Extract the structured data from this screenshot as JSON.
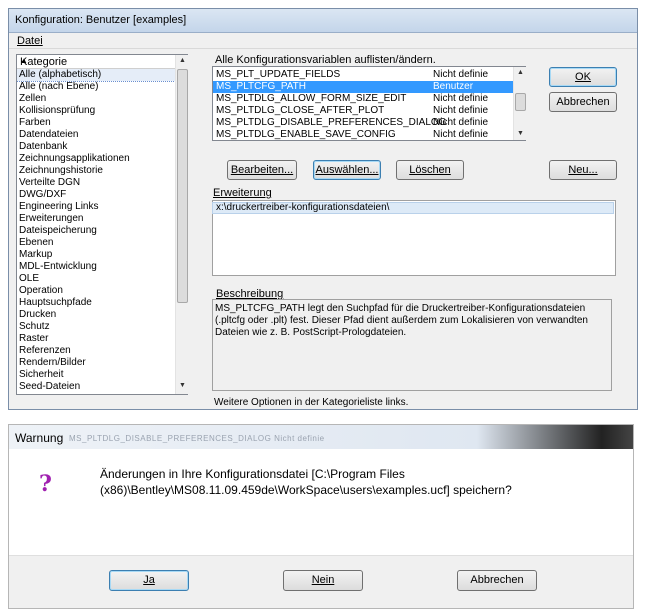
{
  "window": {
    "title": "Konfiguration: Benutzer [examples]"
  },
  "menu": {
    "datei": "Datei"
  },
  "categories": {
    "header": "Kategorie",
    "items": [
      "Alle (alphabetisch)",
      "Alle (nach Ebene)",
      "Zellen",
      "Kollisionsprüfung",
      "Farben",
      "Datendateien",
      "Datenbank",
      "Zeichnungsapplikationen",
      "Zeichnungshistorie",
      "Verteilte DGN",
      "DWG/DXF",
      "Engineering Links",
      "Erweiterungen",
      "Dateispeicherung",
      "Ebenen",
      "Markup",
      "MDL-Entwicklung",
      "OLE",
      "Operation",
      "Hauptsuchpfade",
      "Drucken",
      "Schutz",
      "Raster",
      "Referenzen",
      "Rendern/Bilder",
      "Sicherheit",
      "Seed-Dateien"
    ],
    "selected_index": 0
  },
  "variables": {
    "label": "Alle Konfigurationsvariablen auflisten/ändern.",
    "rows": [
      {
        "name": "MS_PLT_UPDATE_FIELDS",
        "value": "Nicht definie"
      },
      {
        "name": "MS_PLTCFG_PATH",
        "value": "Benutzer"
      },
      {
        "name": "MS_PLTDLG_ALLOW_FORM_SIZE_EDIT",
        "value": "Nicht definie"
      },
      {
        "name": "MS_PLTDLG_CLOSE_AFTER_PLOT",
        "value": "Nicht definie"
      },
      {
        "name": "MS_PLTDLG_DISABLE_PREFERENCES_DIALOG",
        "value": "Nicht definie"
      },
      {
        "name": "MS_PLTDLG_ENABLE_SAVE_CONFIG",
        "value": "Nicht definie"
      }
    ],
    "selected_index": 1
  },
  "buttons": {
    "ok": "OK",
    "abbrechen": "Abbrechen",
    "bearbeiten": "Bearbeiten...",
    "auswaehlen": "Auswählen...",
    "loeschen": "Löschen",
    "neu": "Neu..."
  },
  "erweiterung": {
    "label": "Erweiterung",
    "value": "x:\\druckertreiber-konfigurationsdateien\\"
  },
  "beschreibung": {
    "label": "Beschreibung",
    "text": "MS_PLTCFG_PATH legt den Suchpfad für die Druckertreiber-Konfigurationsdateien (.pltcfg oder .plt) fest. Dieser Pfad dient außerdem zum Lokalisieren von verwandten Dateien wie z. B. PostScript-Prologdateien."
  },
  "footer": "Weitere Optionen in der Kategorieliste links.",
  "warning": {
    "title": "Warnung",
    "ghost_text": "MS_PLTDLG_DISABLE_PREFERENCES_DIALOG    Nicht definie",
    "icon": "question-icon",
    "icon_glyph": "?",
    "icon_color": "#a020b0",
    "message": "Änderungen in Ihre Konfigurationsdatei [C:\\Program Files (x86)\\Bentley\\MS08.11.09.459de\\WorkSpace\\users\\examples.ucf] speichern?",
    "ja": "Ja",
    "nein": "Nein",
    "abbrechen": "Abbrechen"
  },
  "colors": {
    "selection": "#3399ff",
    "default_button_border": "#3c7fb1"
  }
}
